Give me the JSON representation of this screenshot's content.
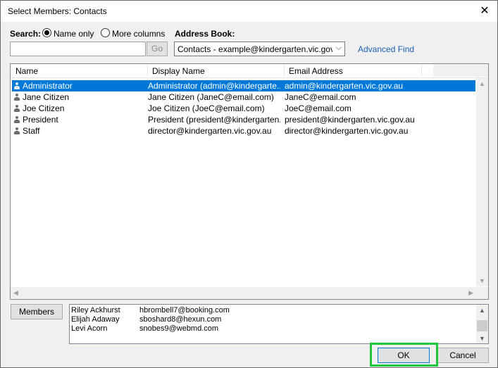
{
  "window": {
    "title": "Select Members: Contacts",
    "close_glyph": "✕"
  },
  "search": {
    "label": "Search:",
    "options": [
      "Name only",
      "More columns"
    ],
    "selected": "Name only",
    "value": "",
    "go_label": "Go"
  },
  "address_book": {
    "label": "Address Book:",
    "value": "Contacts - example@kindergarten.vic.gov.au",
    "advanced_find": "Advanced Find"
  },
  "table": {
    "columns": [
      "Name",
      "Display Name",
      "Email Address"
    ],
    "rows": [
      {
        "name": "Administrator",
        "display": "Administrator (admin@kindergarte...",
        "email": "admin@kindergarten.vic.gov.au",
        "selected": true
      },
      {
        "name": "Jane Citizen",
        "display": "Jane Citizen (JaneC@email.com)",
        "email": "JaneC@email.com",
        "selected": false
      },
      {
        "name": "Joe Citizen",
        "display": "Joe Citizen (JoeC@email.com)",
        "email": "JoeC@email.com",
        "selected": false
      },
      {
        "name": "President",
        "display": "President (president@kindergarten...",
        "email": "president@kindergarten.vic.gov.au",
        "selected": false
      },
      {
        "name": "Staff",
        "display": "director@kindergarten.vic.gov.au",
        "email": "director@kindergarten.vic.gov.au",
        "selected": false
      }
    ]
  },
  "members": {
    "button_label": "Members",
    "list": [
      {
        "name": "Riley Ackhurst",
        "email": "hbrombell7@booking.com"
      },
      {
        "name": "Elijah Adaway",
        "email": "sboshard8@hexun.com"
      },
      {
        "name": "Levi Acorn",
        "email": "snobes9@webmd.com"
      }
    ]
  },
  "buttons": {
    "ok": "OK",
    "cancel": "Cancel"
  },
  "colors": {
    "selection": "#0078d7",
    "link": "#1a5fb4",
    "highlight": "#1fc53b"
  }
}
